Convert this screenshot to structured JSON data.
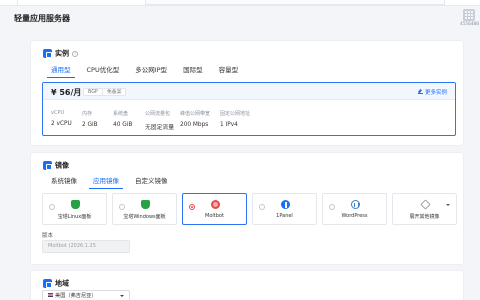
{
  "page": {
    "title": "轻量应用服务器"
  },
  "corner": {
    "code": "4556400"
  },
  "instance": {
    "section_title": "实例",
    "tabs": [
      {
        "label": "通用型",
        "active": true
      },
      {
        "label": "CPU优化型",
        "active": false
      },
      {
        "label": "多公网IP型",
        "active": false
      },
      {
        "label": "国际型",
        "active": false
      },
      {
        "label": "容量型",
        "active": false
      }
    ],
    "plan": {
      "price": "¥ 56/月",
      "tags": [
        "BGP",
        "免备案"
      ],
      "more_link": "更多实例",
      "specs": [
        {
          "key": "vCPU",
          "value": "2 vCPU"
        },
        {
          "key": "内存",
          "value": "2 GiB"
        },
        {
          "key": "系统盘",
          "value": "40 GiB"
        },
        {
          "key": "公网流量包",
          "value": "无固定流量"
        },
        {
          "key": "峰值公网带宽",
          "value": "200 Mbps"
        },
        {
          "key": "固定公网地址",
          "value": "1 IPv4"
        }
      ]
    }
  },
  "image": {
    "section_title": "镜像",
    "tabs": [
      {
        "label": "系统镜像",
        "active": false
      },
      {
        "label": "应用镜像",
        "active": true
      },
      {
        "label": "自定义镜像",
        "active": false
      }
    ],
    "cards": [
      {
        "name": "宝塔Linux面板",
        "icon": "bt-shield-icon",
        "selected": false
      },
      {
        "name": "宝塔Windows面板",
        "icon": "bt-shield-icon",
        "selected": false
      },
      {
        "name": "Moltbot",
        "icon": "moltbot-claw-icon",
        "selected": true
      },
      {
        "name": "1Panel",
        "icon": "1panel-icon",
        "selected": false
      },
      {
        "name": "WordPress",
        "icon": "wordpress-icon",
        "selected": false
      },
      {
        "name": "展开其他镜像",
        "icon": "layers-icon",
        "selected": false
      }
    ],
    "version_label": "版本",
    "version_value": "Moltbot (2026.1.25"
  },
  "region": {
    "section_title": "地域",
    "selected": "美国（弗吉尼亚）"
  },
  "colors": {
    "accent": "#1a6ef5",
    "selected_border": "#2d74f4",
    "bt_green": "#25a244",
    "moltbot_red": "#e5484d"
  }
}
